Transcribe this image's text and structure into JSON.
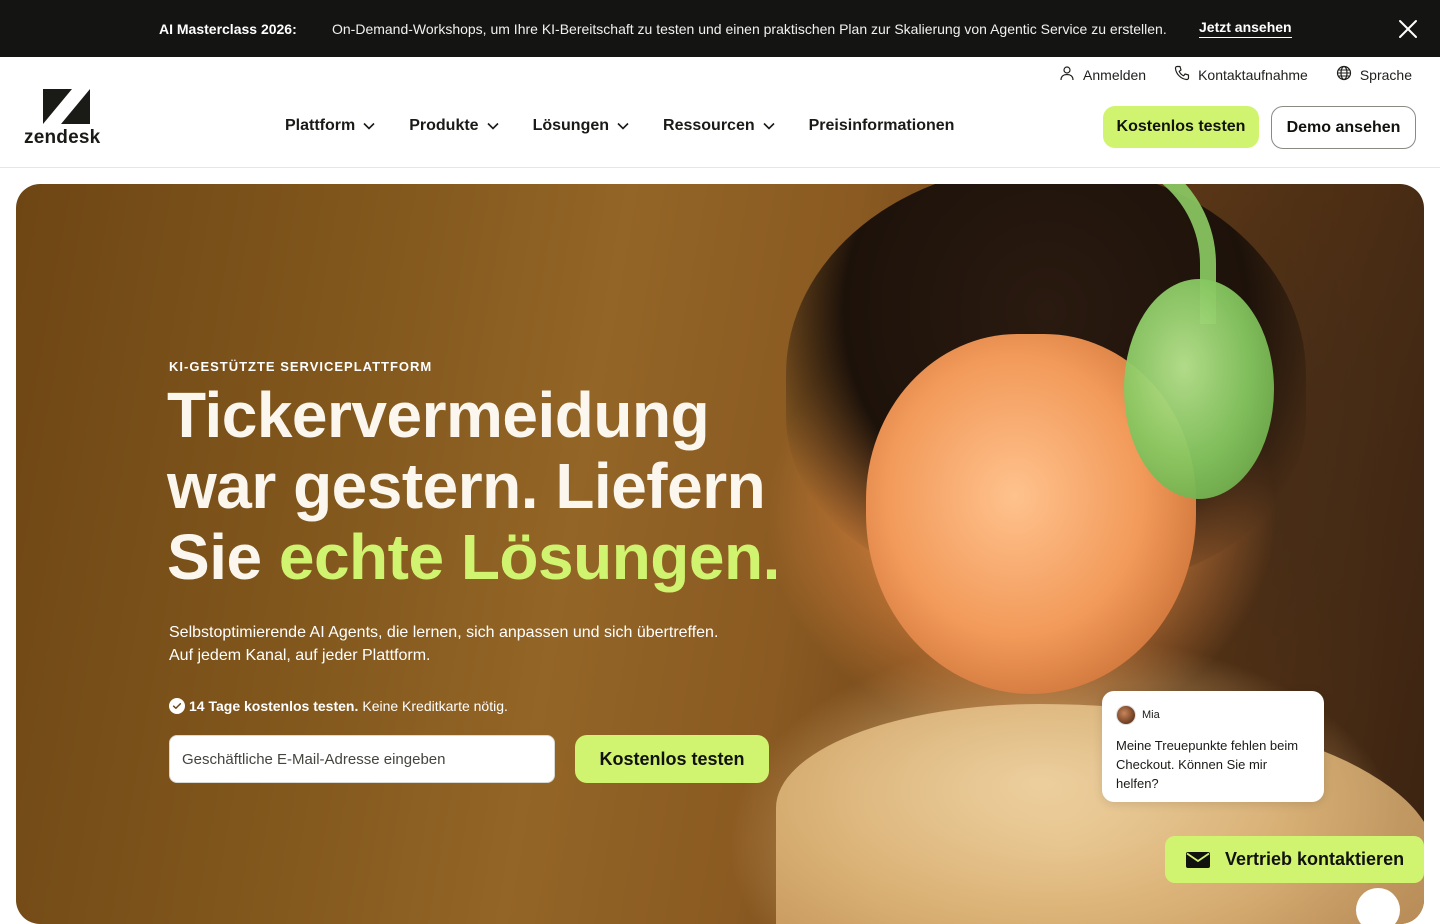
{
  "announcement": {
    "title": "AI Masterclass 2026:",
    "message": "On-Demand-Workshops, um Ihre KI-Bereitschaft zu testen und einen praktischen Plan zur Skalierung von Agentic Service zu erstellen.",
    "cta": "Jetzt ansehen"
  },
  "utility": {
    "login": "Anmelden",
    "contact": "Kontaktaufnahme",
    "language": "Sprache"
  },
  "brand": {
    "name": "zendesk"
  },
  "nav": [
    {
      "label": "Plattform",
      "dropdown": true
    },
    {
      "label": "Produkte",
      "dropdown": true
    },
    {
      "label": "Lösungen",
      "dropdown": true
    },
    {
      "label": "Ressourcen",
      "dropdown": true
    },
    {
      "label": "Preisinformationen",
      "dropdown": false
    }
  ],
  "header_buttons": {
    "trial": "Kostenlos testen",
    "demo": "Demo ansehen"
  },
  "hero": {
    "eyebrow": "KI-GESTÜTZTE SERVICEPLATTFORM",
    "headline_line1": "Tickervermeidung",
    "headline_line2": "war gestern. Liefern",
    "headline_line3_plain": "Sie ",
    "headline_line3_accent": "echte Lösungen.",
    "sub_line1": "Selbstoptimierende AI Agents, die lernen, sich anpassen und sich übertreffen.",
    "sub_line2": "Auf jedem Kanal, auf jeder Plattform.",
    "trial_bold": "14 Tage kostenlos testen.",
    "trial_rest": "Keine Kreditkarte nötig.",
    "email_placeholder": "Geschäftliche E-Mail-Adresse eingeben",
    "cta": "Kostenlos testen"
  },
  "chat": {
    "name": "Mia",
    "message": "Meine Treuepunkte fehlen beim Checkout. Können Sie mir helfen?"
  },
  "contact_sales": "Vertrieb kontaktieren",
  "colors": {
    "accent": "#d1f470",
    "announcement_bg": "#141413"
  }
}
